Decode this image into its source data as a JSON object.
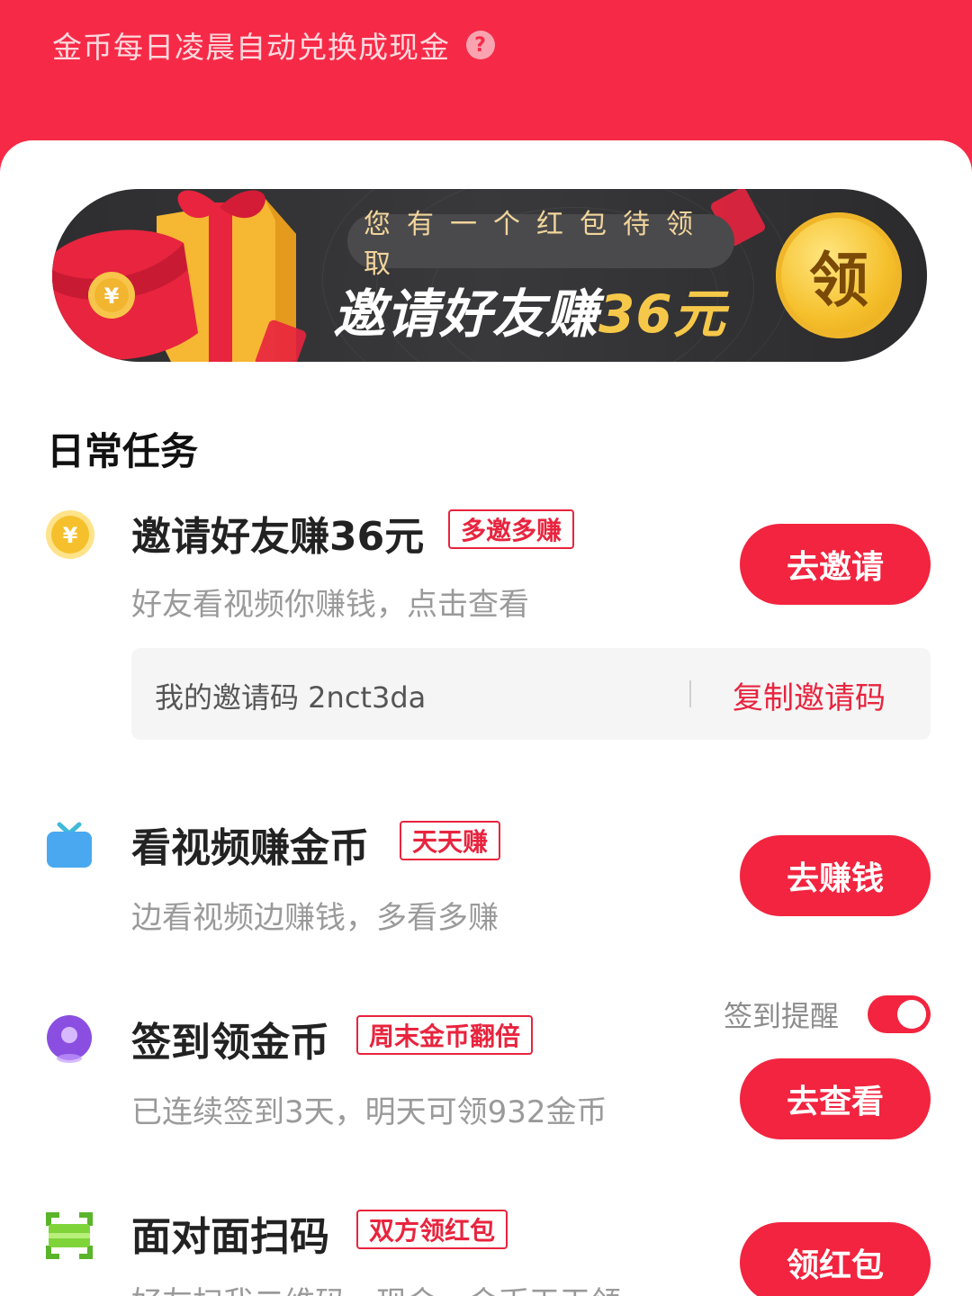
{
  "header": {
    "notice": "金币每日凌晨自动兑换成现金",
    "help_icon": "?"
  },
  "banner": {
    "pill_text": "您有一个红包待领取",
    "title_prefix": "邀请好友赚",
    "title_amount": "36元",
    "coin_char": "领"
  },
  "section": {
    "title": "日常任务"
  },
  "tasks": [
    {
      "icon": "yen-coin-icon",
      "icon_char": "¥",
      "title": "邀请好友赚36元",
      "tag": "多邀多赚",
      "desc": "好友看视频你赚钱，点击查看",
      "button": "去邀请"
    },
    {
      "icon": "tv-icon",
      "title": "看视频赚金币",
      "tag": "天天赚",
      "desc": "边看视频边赚钱，多看多赚",
      "button": "去赚钱"
    },
    {
      "icon": "location-pin-icon",
      "title": "签到领金币",
      "tag": "周末金币翻倍",
      "desc": "已连续签到3天，明天可领932金币",
      "button": "去查看"
    },
    {
      "icon": "scan-icon",
      "title": "面对面扫码",
      "tag": "双方领红包",
      "desc": "好友扫我二维码，现金、金币天天领",
      "button": "领红包"
    }
  ],
  "invite_code": {
    "label": "我的邀请码 2nct3da",
    "copy": "复制邀请码"
  },
  "checkin_reminder": {
    "label": "签到提醒",
    "enabled": true
  },
  "colors": {
    "brand_red": "#f2243f",
    "header_red": "#f62a47",
    "coin_gold": "#f5c02c",
    "tv_blue": "#4aa8f0",
    "pin_purple": "#8a4fe0",
    "scan_green": "#7fd43a"
  }
}
